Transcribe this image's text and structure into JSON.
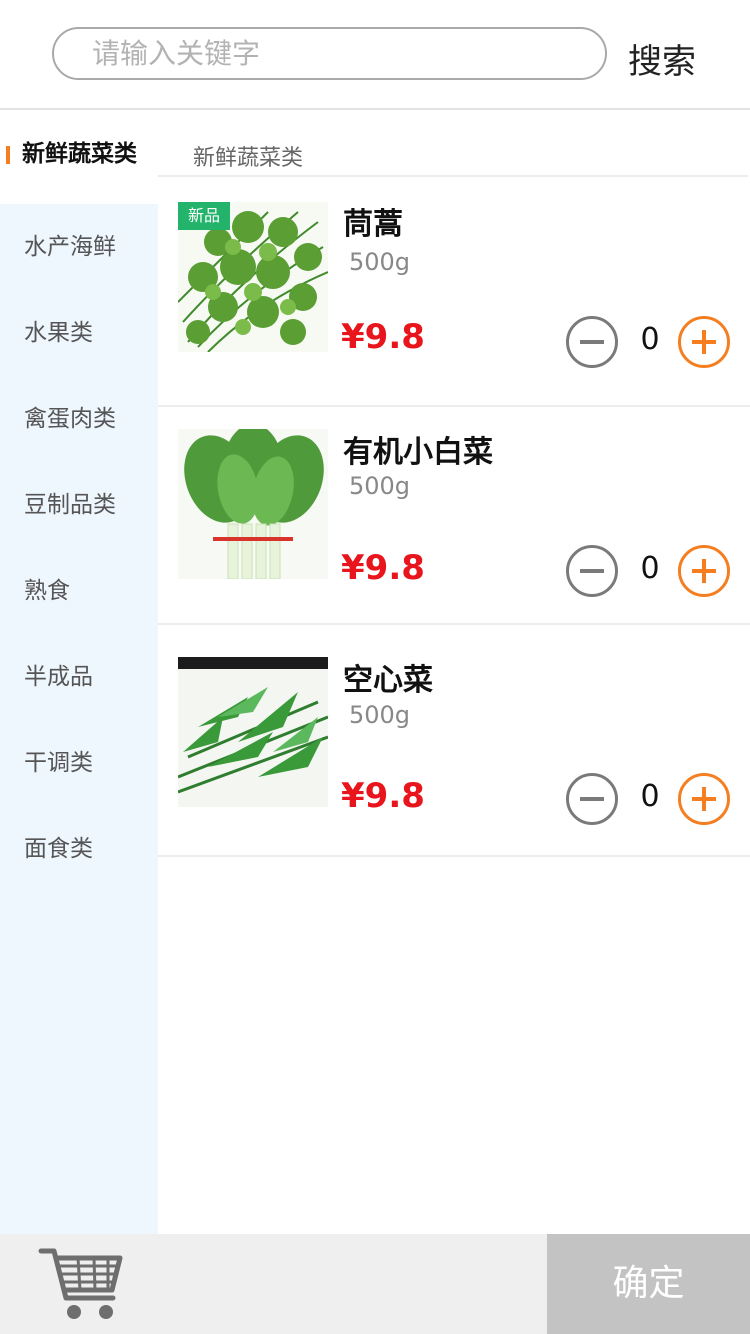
{
  "search": {
    "placeholder": "请输入关键字",
    "value": "",
    "button_label": "搜索"
  },
  "sidebar": {
    "items": [
      {
        "label": "新鲜蔬菜类",
        "active": true
      },
      {
        "label": "水产海鲜"
      },
      {
        "label": "水果类"
      },
      {
        "label": "禽蛋肉类"
      },
      {
        "label": "豆制品类"
      },
      {
        "label": "熟食"
      },
      {
        "label": "半成品"
      },
      {
        "label": "干调类"
      },
      {
        "label": "面食类"
      }
    ]
  },
  "main": {
    "section_title": "新鲜蔬菜类",
    "products": [
      {
        "name": "茼蒿",
        "spec": "500g",
        "price": "¥9.8",
        "qty": "0",
        "badge": "新品"
      },
      {
        "name": "有机小白菜",
        "spec": "500g",
        "price": "¥9.8",
        "qty": "0"
      },
      {
        "name": "空心菜",
        "spec": "500g",
        "price": "¥9.8",
        "qty": "0"
      }
    ]
  },
  "footer": {
    "confirm_label": "确定",
    "cart_icon": "shopping-cart-icon"
  },
  "colors": {
    "accent": "#f47e20",
    "price": "#e8161c",
    "badge": "#23b36a",
    "sidebar_bg": "#eef6fe",
    "confirm_bg": "#c3c3c3"
  }
}
